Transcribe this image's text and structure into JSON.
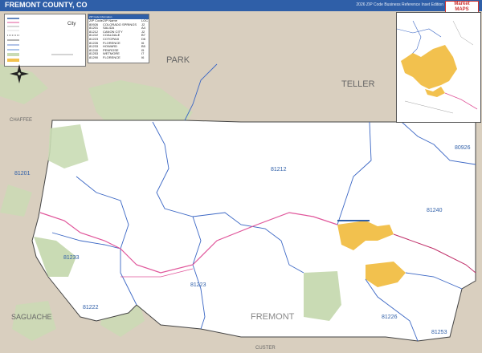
{
  "map": {
    "title": "FREMONT COUNTY, CO",
    "edition": "2026 ZIP Code Business Reference Inset Edition",
    "logo_text": [
      "Market",
      "MAPS"
    ],
    "colors": {
      "background": "#d9cfbf",
      "county_fill": "#ffffff",
      "public_land": "#c9dbb4",
      "urban": "#f2c14e",
      "zip_boundary": "#3a66c4",
      "highway": "#e0559a",
      "water": "#5b8dd6",
      "title_bar": "#2f5fa8"
    }
  },
  "labels": {
    "neighbors": {
      "park": "PARK",
      "teller": "TELLER",
      "chaffee": "CHAFFEE",
      "saguache": "SAGUACHE",
      "custer": "CUSTER"
    },
    "county": "FREMONT",
    "zips": {
      "z81212": "81212",
      "z81201": "81201",
      "z80926": "80926",
      "z81240": "81240",
      "z81233": "81233",
      "z81223": "81223",
      "z81222": "81222",
      "z81226": "81226",
      "z81253": "81253"
    }
  },
  "zip_table": {
    "header": "ZIP Code Information",
    "columns": [
      "ZIP Code",
      "ZIP Name",
      "LOC"
    ],
    "rows": [
      {
        "zip": "80926",
        "name": "COLORADO SPRINGS",
        "loc": "J2"
      },
      {
        "zip": "81201",
        "name": "SALIDA",
        "loc": "A4"
      },
      {
        "zip": "81212",
        "name": "CANON CITY",
        "loc": "J2"
      },
      {
        "zip": "81222",
        "name": "COALDALE",
        "loc": "B7"
      },
      {
        "zip": "81223",
        "name": "COTOPAXI",
        "loc": "D6"
      },
      {
        "zip": "81226",
        "name": "FLORENCE",
        "loc": "I6"
      },
      {
        "zip": "81233",
        "name": "HOWARD",
        "loc": "B5"
      },
      {
        "zip": "81240",
        "name": "PENROSE",
        "loc": "I5"
      },
      {
        "zip": "81253",
        "name": "WETMORE",
        "loc": "I7"
      },
      {
        "zip": "81290",
        "name": "FLORENCE",
        "loc": "I6"
      }
    ]
  },
  "legend": {
    "city_label": "City",
    "items": [
      "Interstate",
      "US Highway",
      "State Highway",
      "County Road",
      "Railroad",
      "Airport",
      "County Boundary",
      "ZIP Boundary",
      "Water",
      "Public Land",
      "Urban Area"
    ]
  }
}
